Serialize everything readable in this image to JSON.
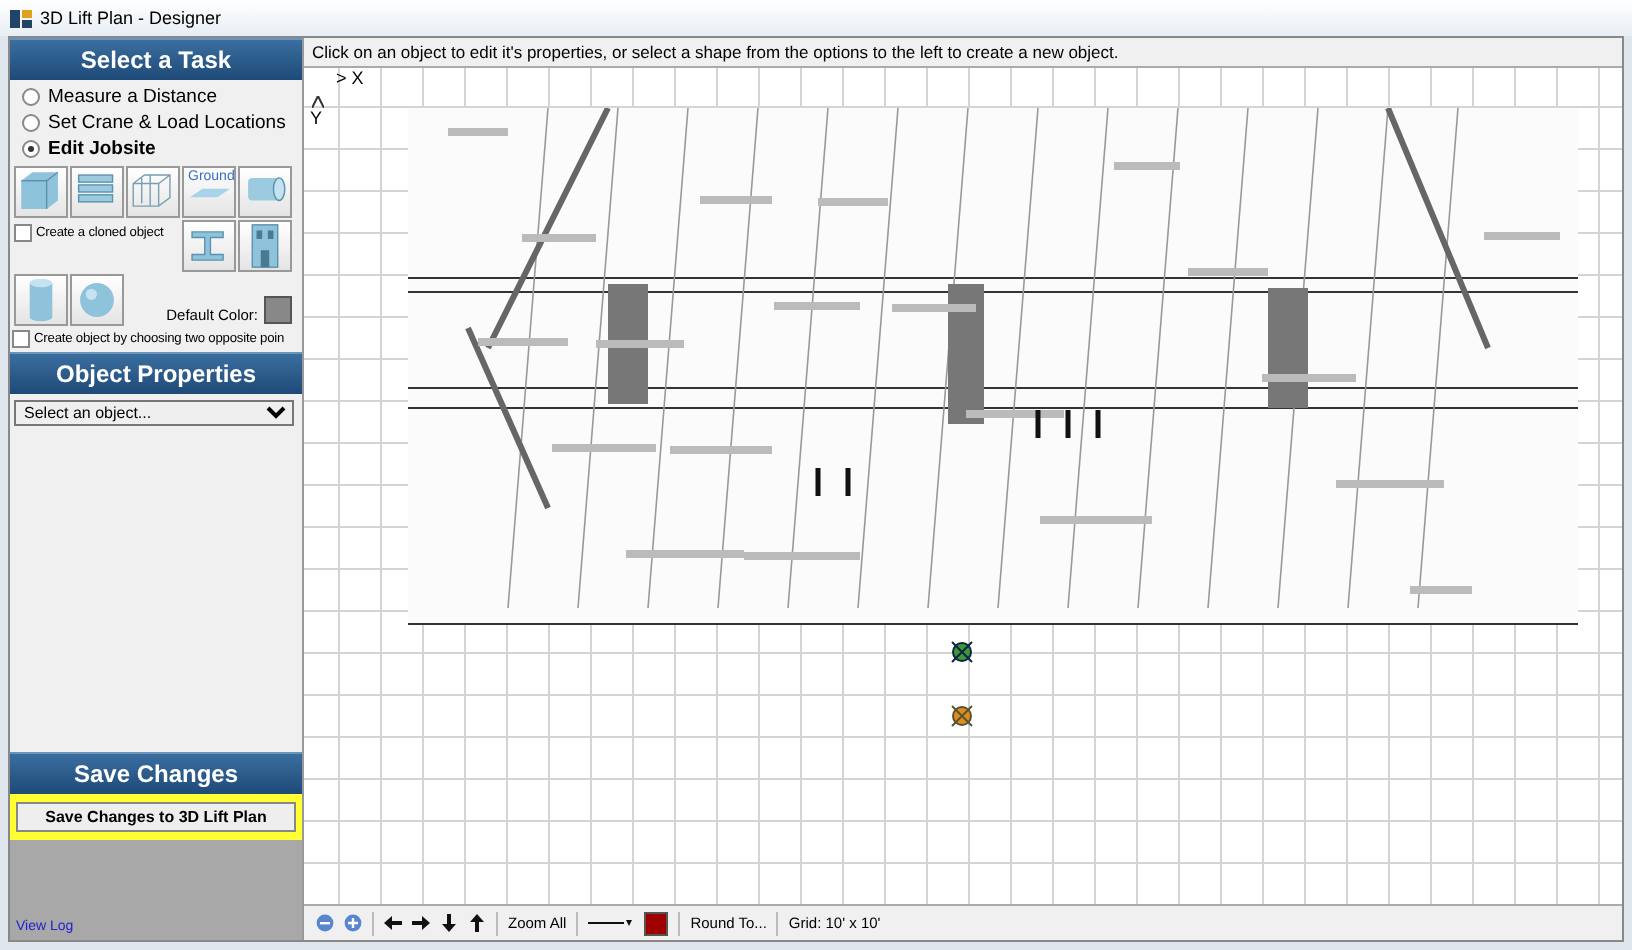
{
  "window": {
    "title": "3D Lift Plan - Designer"
  },
  "task_panel": {
    "title": "Select a Task",
    "options": [
      {
        "label": "Measure a Distance",
        "selected": false
      },
      {
        "label": "Set Crane & Load Locations",
        "selected": false
      },
      {
        "label": "Edit Jobsite",
        "selected": true
      }
    ]
  },
  "shape_tiles": [
    {
      "kind": "box"
    },
    {
      "kind": "stack"
    },
    {
      "kind": "wireframe"
    },
    {
      "kind": "ground",
      "label": "Ground"
    },
    {
      "kind": "log"
    },
    {
      "kind": "beam"
    },
    {
      "kind": "wall"
    },
    {
      "kind": "cylinder"
    },
    {
      "kind": "sphere"
    }
  ],
  "clone_option": {
    "label": "Create a cloned object",
    "checked": false
  },
  "default_color": {
    "label": "Default Color:"
  },
  "two_point_option": {
    "label": "Create object by choosing two opposite poin",
    "checked": false
  },
  "object_properties": {
    "title": "Object Properties",
    "select": "Select an object..."
  },
  "save_panel": {
    "title": "Save Changes",
    "button": "Save Changes to 3D Lift Plan"
  },
  "view_link": "View Log",
  "instruction": "Click on an object to edit it's properties, or select a shape from the options to the left to create a new object.",
  "axes": {
    "x": "> X",
    "y": "Y"
  },
  "toolbar": {
    "zoom_all": "Zoom All",
    "round": "Round To...",
    "grid": "Grid: 10' x 10'"
  }
}
